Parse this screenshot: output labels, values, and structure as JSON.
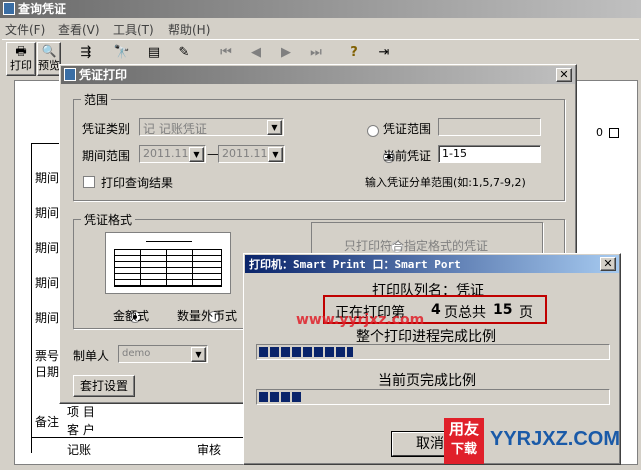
{
  "main_window": {
    "title": "查询凭证",
    "menu": [
      "文件(F)",
      "查看(V)",
      "工具(T)",
      "帮助(H)"
    ],
    "tool_labels": [
      "打印",
      "预览"
    ],
    "left_labels": [
      "期间",
      "期间",
      "期间",
      "期间",
      "期间",
      "票号",
      "日期"
    ],
    "bottom": {
      "note": "备注",
      "item": "项  目",
      "customer": "客  户",
      "bookkeep": "记账",
      "audit": "审核"
    },
    "right_indicator": "0"
  },
  "print_dialog": {
    "title": "凭证打印",
    "range_group": "范围",
    "voucher_type_label": "凭证类别",
    "voucher_type_value": "记   记账凭证",
    "period_label": "期间范围",
    "period_from": "2011.11",
    "period_to": "2011.11",
    "period_dash": "—",
    "print_query_result": "打印查询结果",
    "voucher_range_radio": "凭证范围",
    "current_voucher_radio": "当前凭证",
    "current_voucher_value": "1-15",
    "hint": "输入凭证分单范围(如:1,5,7-9,2)",
    "format_group": "凭证格式",
    "amount_format": "金额式",
    "foreign_format": "数量外币式",
    "only_matching": "只打印符合指定格式的凭证",
    "maker_label": "制单人",
    "maker_value": "demo",
    "print_settings_button": "套打设置"
  },
  "printer_dialog": {
    "title": "打印机：Smart Print 口：Smart Port",
    "queue_label": "打印队列名：凭证",
    "status_prefix": "正在打印第",
    "status_page": "4",
    "status_middle": "页总共",
    "status_total": "15",
    "status_suffix": "页",
    "overall_label": "整个打印进程完成比例",
    "page_label": "当前页完成比例",
    "cancel_button": "取消",
    "overall_progress": 0.27,
    "page_progress": 0.12
  },
  "watermarks": {
    "url": "www.yyrjxz.com",
    "brand": "YYRJXZ.COM",
    "logo_top": "用友",
    "logo_bottom": "下载"
  },
  "colors": {
    "title_active": "#0a246a",
    "progress": "#0a246a",
    "highlight_border": "#c00000",
    "watermark_red": "#e0202a",
    "brand_blue": "#1a5aa8"
  }
}
